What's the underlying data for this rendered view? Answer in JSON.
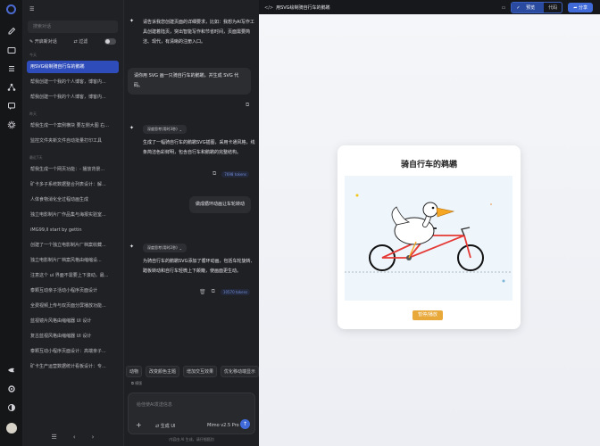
{
  "sidebar": {
    "search_placeholder": "搜索对话",
    "new_chat_label": "开启新对话",
    "filter_label": "过滤",
    "groups": [
      {
        "label": "今天",
        "items": [
          "用SVG绘制骑自行车的鹅鹕",
          "帮我创建一个我的个人博客，博客内...",
          "帮我创建一个我的个人博客，博客内..."
        ]
      },
      {
        "label": "昨天",
        "items": [
          "帮我生成一个案例横块 要左侧大图 右...",
          "监控文件夹新文件自动批量打印工具"
        ]
      },
      {
        "label": "最近7天",
        "items": [
          "帮我生成一个网页功能：- 播放背景...",
          "矿卡多子系统数据整合列表设计：解...",
          "人体食物消化全过程动画生成",
          "独立电影制片厂作品集与海报实验室...",
          "iMG99,ll start by gettin",
          "创建了一个独立电影制片厂档案收藏...",
          "独立电影制片厂档案风格由缩缩设...",
          "注意这个 ui 界面不需要上下滚动，最...",
          "泰颗互动亲子活动小程序页面设计",
          "全费视频上传与双页面分屏播放功能...",
          "蓝视镜片风格由缩缩器 UI 设计",
          "复古蓝视风格由缩缩器 UI 设计",
          "泰颗互动小程序页面设计：高端亲子...",
          "矿卡生产运营数据统计看板设计：专..."
        ]
      }
    ]
  },
  "chat": {
    "messages": [
      {
        "role": "assistant",
        "text": "请告诉我您创建页面的详细要求，比如：我想为AI写作工具创建着陆页，突出智能写作和节省时间，页面需要简洁、现代，有清晰的注册入口。"
      },
      {
        "role": "user",
        "text": "请你用 SVG 画一只骑自行车的鹅鹕，并生成 SVG 代码。"
      },
      {
        "role": "assistant",
        "think": "深度思考(用时3秒)",
        "text": "生成了一幅骑自行车的鹅鹕SVG插图，采用卡通风格，线条简洁色彩鲜明，包含自行车和鹅鹕的完整结构。",
        "tokens": "7698 tokens"
      },
      {
        "role": "user",
        "text": "做成循环动画让车轮转动"
      },
      {
        "role": "assistant",
        "think": "深度思考(用时2秒)",
        "text": "为骑自行车的鹅鹕SVG添加了循环动画，包括车轮旋转、踏板转动和自行车轻微上下颠簸，使画面更生动。",
        "tokens": "10570 tokens"
      }
    ],
    "chips": [
      "动物",
      "改变颜色主题",
      "增加交互效果",
      "优化移动端显示"
    ],
    "quick_action": "模版",
    "input_placeholder": "给佳使AI发送信息",
    "tool_label": "生成 UI",
    "model_label": "Mimo v2.5 Pro",
    "disclaimer": "内容由 AI 生成，请仔细甄别"
  },
  "preview": {
    "title": "用SVG绘制骑自行车的鹅鹕",
    "toggle": {
      "preview": "预览",
      "code": "代码"
    },
    "share_label": "分享",
    "card_title": "骑自行车的鹈鹕",
    "pause_label": "暂停/播放",
    "colors": {
      "accent": "#3f6ad8",
      "pause": "#e8a83a",
      "frame": "#e53935",
      "beak": "#f5a623"
    }
  }
}
